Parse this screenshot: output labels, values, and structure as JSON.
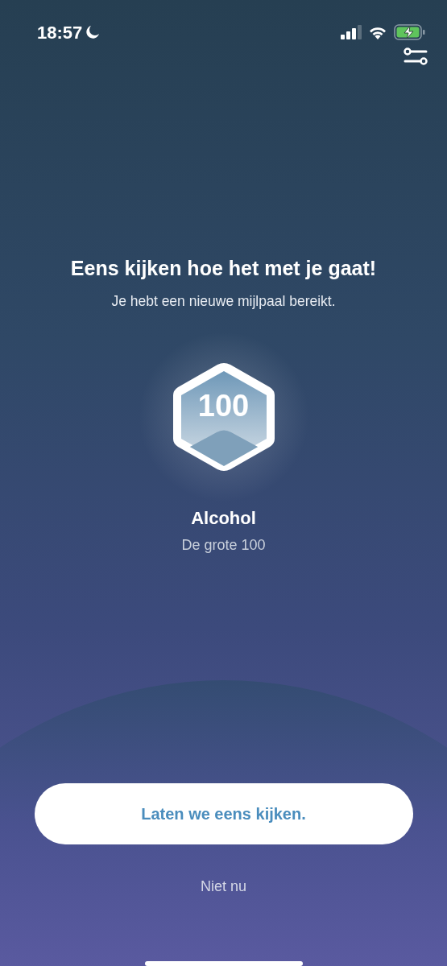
{
  "status_bar": {
    "time": "18:57",
    "do_not_disturb": true,
    "battery_charging": true
  },
  "header": {
    "filter_button": true
  },
  "title": "Eens kijken hoe het met je gaat!",
  "subtitle": "Je hebt een nieuwe mijlpaal bereikt.",
  "milestone": {
    "number": "100",
    "category": "Alcohol",
    "name": "De grote 100"
  },
  "primary_button": "Laten we eens kijken.",
  "secondary_link": "Niet nu"
}
